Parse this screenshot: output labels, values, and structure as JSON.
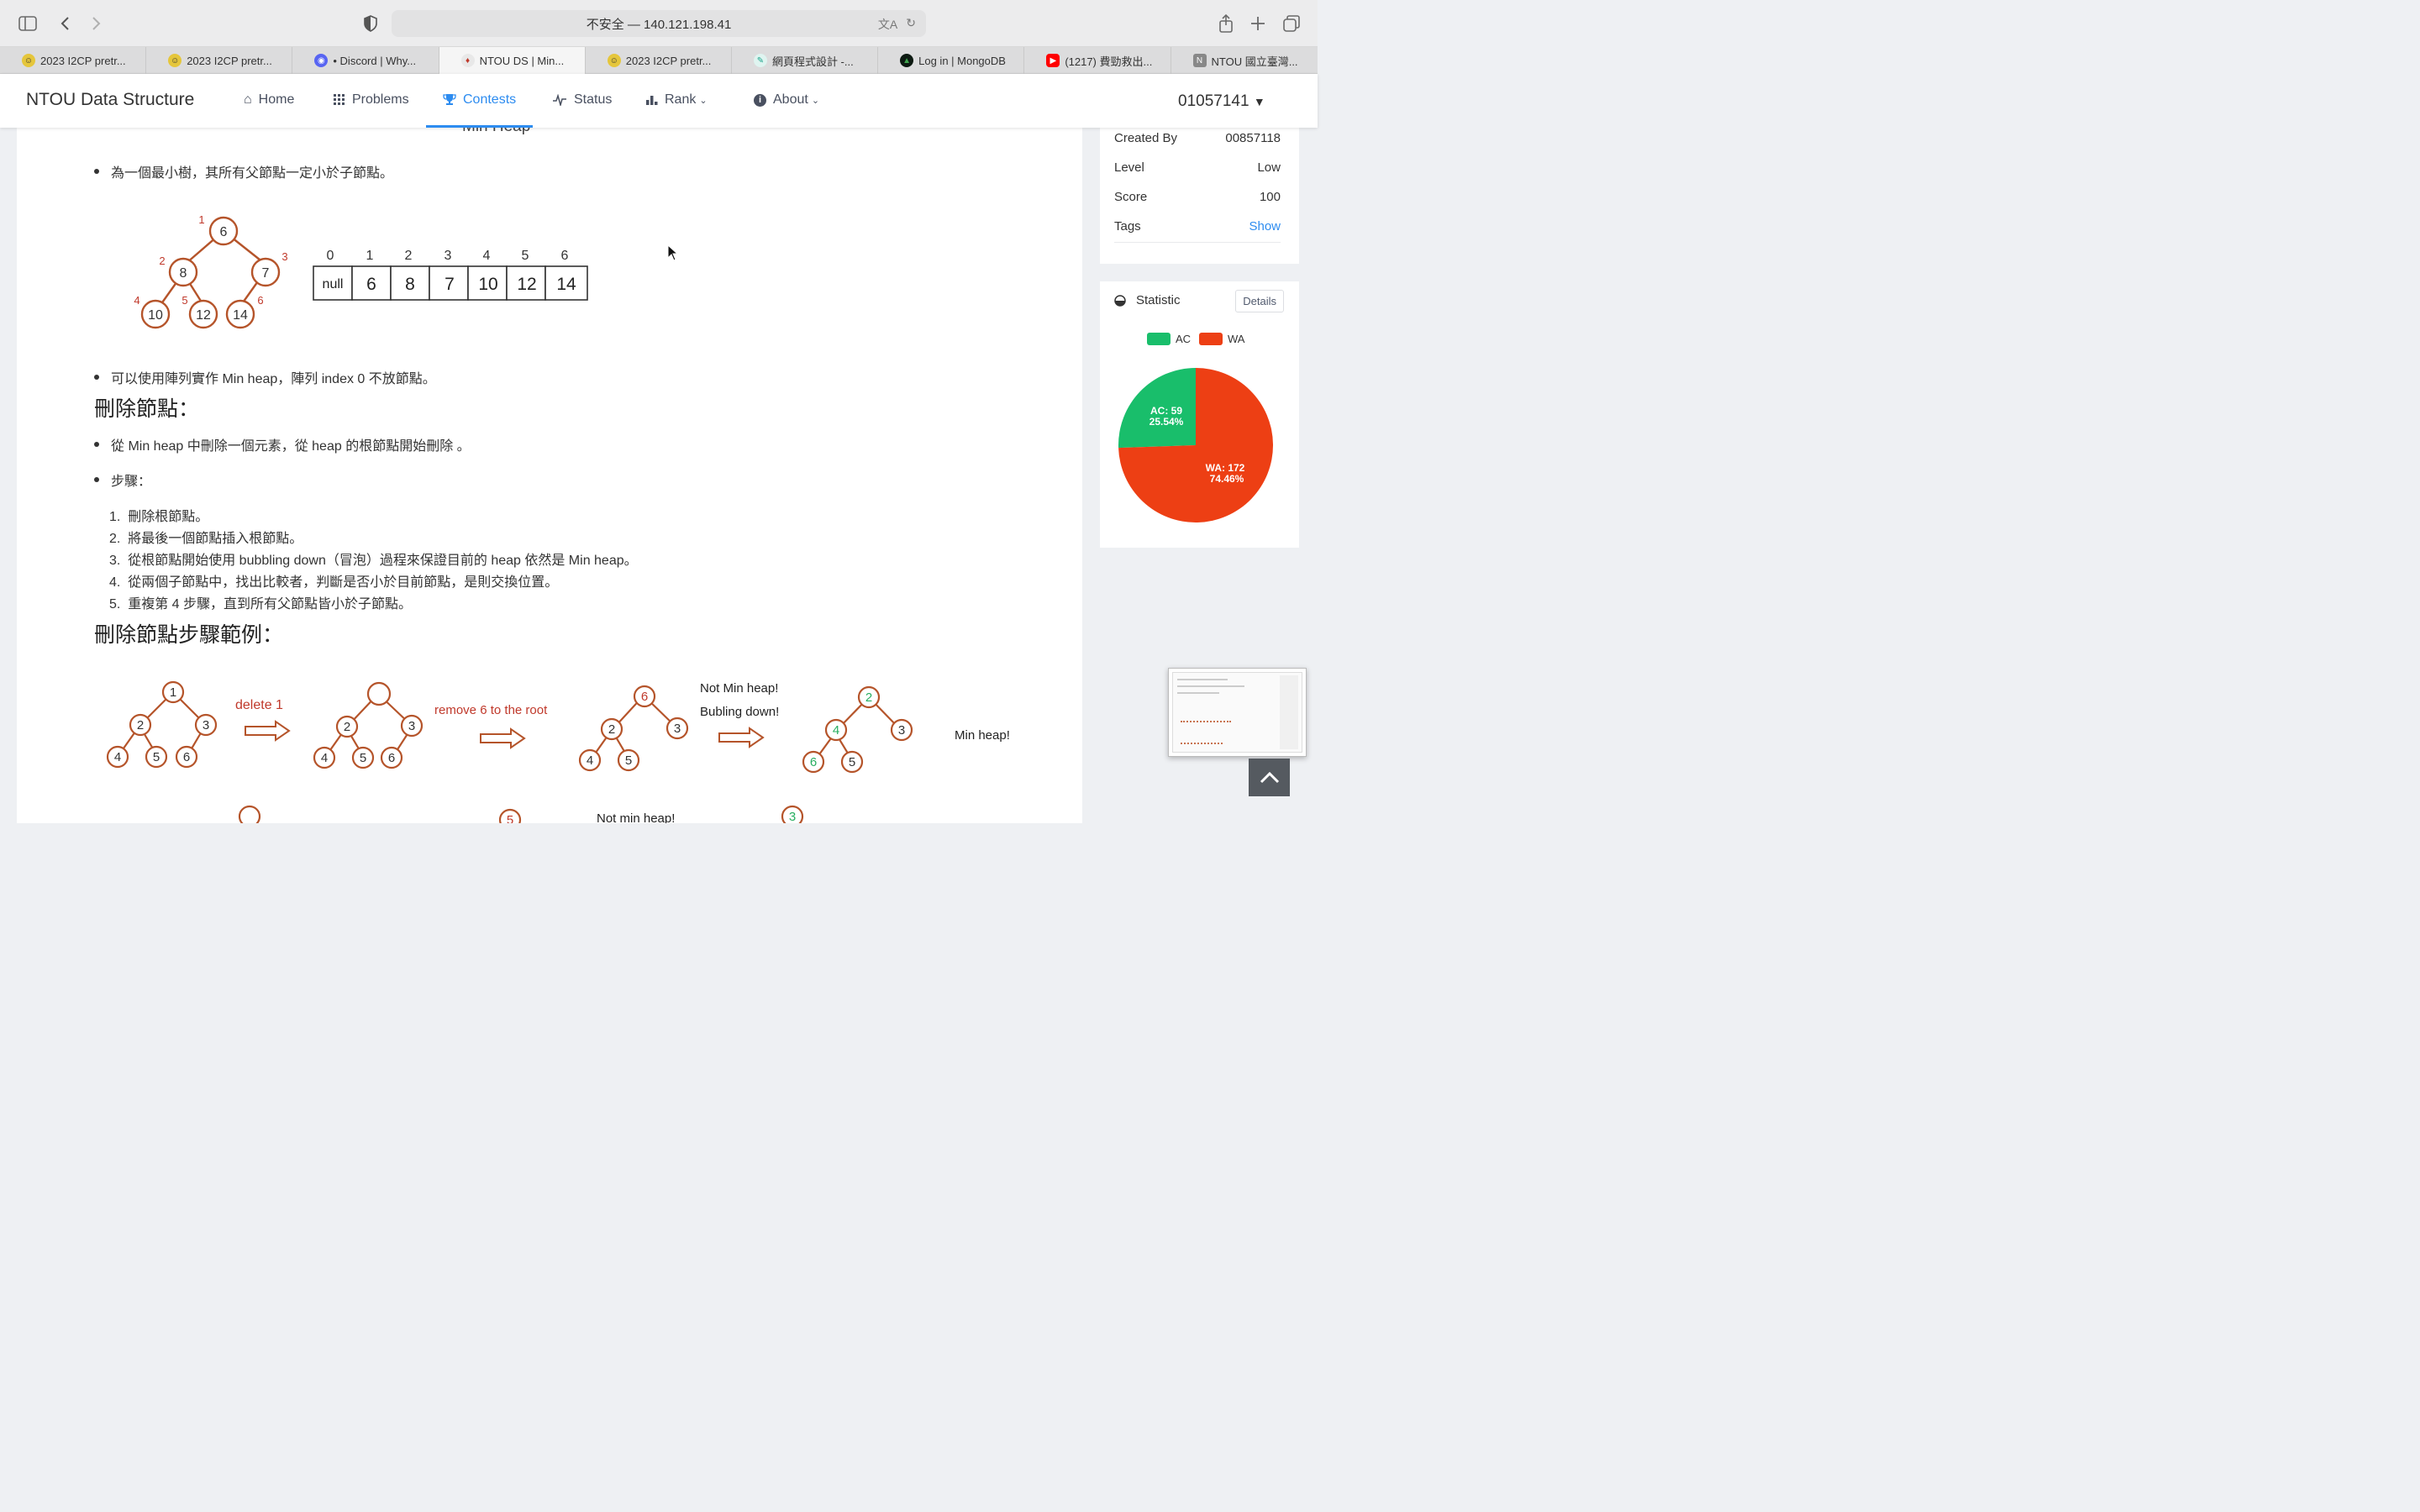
{
  "browser": {
    "url": "不安全 — 140.121.198.41",
    "tabs": [
      {
        "label": "2023 I2CP pretr...",
        "icon": "emoji-icon",
        "active": false
      },
      {
        "label": "2023 I2CP pretr...",
        "icon": "emoji-icon",
        "active": false
      },
      {
        "label": "• Discord | Why...",
        "icon": "discord-icon",
        "active": false
      },
      {
        "label": "NTOU DS | Min...",
        "icon": "balloon-icon",
        "active": true
      },
      {
        "label": "2023 I2CP pretr...",
        "icon": "emoji-icon",
        "active": false
      },
      {
        "label": "網頁程式設計 -...",
        "icon": "pen-icon",
        "active": false
      },
      {
        "label": "Log in | MongoDB",
        "icon": "mongodb-icon",
        "active": false
      },
      {
        "label": "(1217) 費勁救出...",
        "icon": "youtube-icon",
        "active": false
      },
      {
        "label": "NTOU 國立臺灣...",
        "icon": "notion-icon",
        "active": false
      }
    ]
  },
  "nav": {
    "brand": "NTOU Data Structure",
    "home": "Home",
    "problems": "Problems",
    "contests": "Contests",
    "status": "Status",
    "rank": "Rank",
    "about": "About",
    "user": "01057141"
  },
  "content": {
    "cut_heading": "Min Heap",
    "bullet1": "為一個最小樹，其所有父節點一定小於子節點。",
    "tree1": {
      "nodes": [
        "6",
        "8",
        "7",
        "10",
        "12",
        "14"
      ],
      "indices": [
        "1",
        "2",
        "3",
        "4",
        "5",
        "6"
      ]
    },
    "array": {
      "indices": [
        "0",
        "1",
        "2",
        "3",
        "4",
        "5",
        "6"
      ],
      "values": [
        "null",
        "6",
        "8",
        "7",
        "10",
        "12",
        "14"
      ]
    },
    "bullet2": "可以使用陣列實作 Min heap，陣列 index 0 不放節點。",
    "heading_delete": "刪除節點：",
    "bullet3": "從 Min heap 中刪除一個元素，從 heap 的根節點開始刪除 。",
    "bullet4": "步驟：",
    "steps": [
      "刪除根節點。",
      "將最後一個節點插入根節點。",
      "從根節點開始使用 bubbling down（冒泡）過程來保證目前的 heap 依然是 Min heap。",
      "從兩個子節點中，找出比較者，判斷是否小於目前節點，是則交換位置。",
      "重複第 4 步驟，直到所有父節點皆小於子節點。"
    ],
    "heading_example": "刪除節點步驟範例：",
    "diagram": {
      "tree_a": [
        "1",
        "2",
        "3",
        "4",
        "5",
        "6"
      ],
      "label_delete": "delete",
      "label_delete_num": "1",
      "tree_b": [
        "",
        "2",
        "3",
        "4",
        "5",
        "6"
      ],
      "label_remove": "remove",
      "label_remove_num": "6",
      "label_remove_rest": "to the root",
      "tree_c": [
        "6",
        "2",
        "3",
        "4",
        "5"
      ],
      "label_not1": "Not Min heap!",
      "label_not2": "Bubling down!",
      "tree_d": [
        "2",
        "4",
        "3",
        "6",
        "5"
      ],
      "label_min": "Min heap!",
      "label_not_min": "Not  min heap!",
      "partial_nodes": [
        "5",
        "3"
      ]
    }
  },
  "sidebar": {
    "info": [
      {
        "label": "Created By",
        "value": "00857118"
      },
      {
        "label": "Level",
        "value": "Low"
      },
      {
        "label": "Score",
        "value": "100"
      },
      {
        "label": "Tags",
        "value": "Show"
      }
    ],
    "statistic_title": "Statistic",
    "details_button": "Details",
    "legend": [
      {
        "label": "AC",
        "color": "#19be6b"
      },
      {
        "label": "WA",
        "color": "#ed3f14"
      }
    ],
    "ac_label": "AC: 59",
    "ac_pct": "25.54%",
    "wa_label": "WA: 172",
    "wa_pct": "74.46%"
  },
  "chart_data": {
    "type": "pie",
    "categories": [
      "AC",
      "WA"
    ],
    "values": [
      59,
      172
    ],
    "percents": [
      25.54,
      74.46
    ],
    "colors": [
      "#19be6b",
      "#ed3f14"
    ],
    "legend_position": "top"
  }
}
